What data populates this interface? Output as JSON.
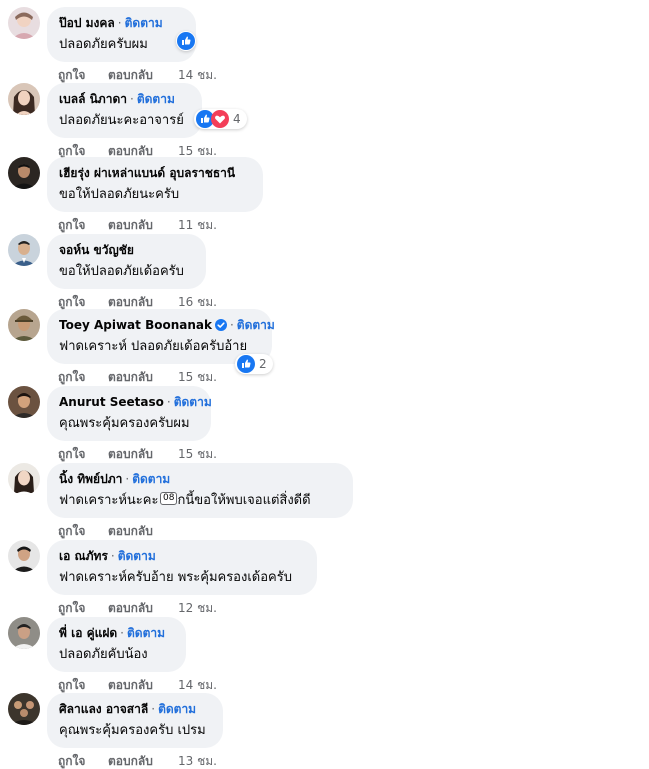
{
  "actions": {
    "like_label": "ถูกใจ",
    "reply_label": "ตอบกลับ"
  },
  "follow_label": "ติดตาม",
  "comments": [
    {
      "author": "ป๊อป มงคล",
      "text": "ปลอดภัยครับผม",
      "time": "14 ชม.",
      "reactions": [
        "like"
      ],
      "reaction_count": ""
    },
    {
      "author": "เบลล์ นิภาดา",
      "text": "ปลอดภัยนะคะอาจารย์",
      "time": "15 ชม.",
      "reactions": [
        "like",
        "love"
      ],
      "reaction_count": "4"
    },
    {
      "author": "เฮียรุ่ง ผ่าเหล่าแบนด์ อุบลราชธานี",
      "text": "ขอให้ปลอดภัยนะครับ",
      "time": "11 ชม."
    },
    {
      "author": "จอห์น ขวัญชัย",
      "text": "ขอให้ปลอดภัยเด้อครับ",
      "time": "16 ชม."
    },
    {
      "author": "Toey Apiwat Boonanak",
      "verified": true,
      "text": "ฟาดเคราะห์ ปลอดภัยเด้อครับอ้าย",
      "time": "15 ชม.",
      "reactions": [
        "like"
      ],
      "reaction_count": "2"
    },
    {
      "author": "Anurut Seetaso",
      "text": "คุณพระคุ้มครองครับผม",
      "time": "15 ชม."
    },
    {
      "author": "นิ้ง ทิพย์ปภา",
      "text": "ฟาดเคราะห์นะคะ จากนี้ขอให้พบเจอแต่สิ่งดีดี",
      "overlay_chip": "08",
      "time": ""
    },
    {
      "author": "เอ ณภัทร",
      "text": "ฟาดเคราะห์ครับอ้าย พระคุ้มครองเด้อครับ",
      "time": "12 ชม."
    },
    {
      "author": "พี่ เอ คู่แฝด",
      "text": "ปลอดภัยคับน้อง",
      "time": "14 ชม."
    },
    {
      "author": "ศิลาแลง อาจสาลี",
      "text": "คุณพระคุ้มครองครับ เปรม",
      "time": "13 ชม."
    }
  ],
  "colors": {
    "bubble": "#f0f2f5",
    "follow": "#216fdb",
    "meta": "#65676b",
    "like": "#1877f2",
    "love": "#f33e58"
  },
  "icons": {
    "like": "thumbs-up-icon",
    "love": "heart-icon",
    "verified": "verified-badge-icon"
  }
}
